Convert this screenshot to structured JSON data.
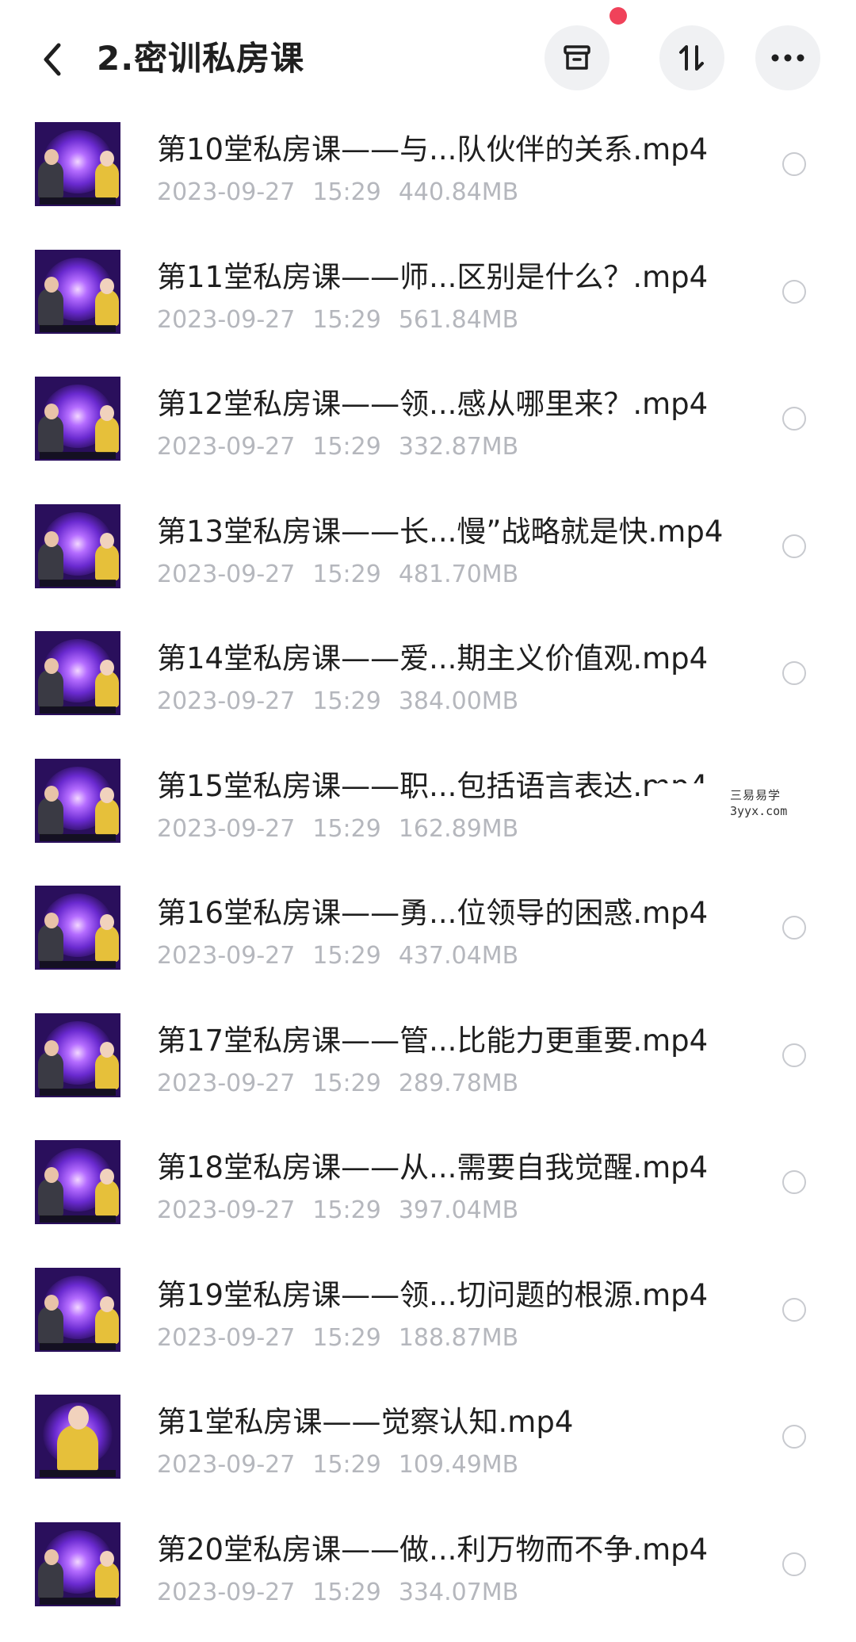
{
  "header": {
    "title": "2.密训私房课",
    "back_icon": "chevron-left-icon",
    "archive_icon": "archive-box-icon",
    "sort_icon": "sort-arrows-icon",
    "more_icon": "more-dots-icon",
    "notification_dot_color": "#f0425a"
  },
  "files": [
    {
      "name": "第10堂私房课——与...队伙伴的关系.mp4",
      "date": "2023-09-27",
      "time": "15:29",
      "size": "440.84MB",
      "thumb": "duo"
    },
    {
      "name": "第11堂私房课——师...区别是什么？.mp4",
      "date": "2023-09-27",
      "time": "15:29",
      "size": "561.84MB",
      "thumb": "duo"
    },
    {
      "name": "第12堂私房课——领...感从哪里来？.mp4",
      "date": "2023-09-27",
      "time": "15:29",
      "size": "332.87MB",
      "thumb": "duo"
    },
    {
      "name": "第13堂私房课——长...慢”战略就是快.mp4",
      "date": "2023-09-27",
      "time": "15:29",
      "size": "481.70MB",
      "thumb": "duo"
    },
    {
      "name": "第14堂私房课——爱...期主义价值观.mp4",
      "date": "2023-09-27",
      "time": "15:29",
      "size": "384.00MB",
      "thumb": "duo"
    },
    {
      "name": "第15堂私房课——职...包括语言表达.mp4",
      "date": "2023-09-27",
      "time": "15:29",
      "size": "162.89MB",
      "thumb": "duo"
    },
    {
      "name": "第16堂私房课——勇...位领导的困惑.mp4",
      "date": "2023-09-27",
      "time": "15:29",
      "size": "437.04MB",
      "thumb": "duo"
    },
    {
      "name": "第17堂私房课——管...比能力更重要.mp4",
      "date": "2023-09-27",
      "time": "15:29",
      "size": "289.78MB",
      "thumb": "duo"
    },
    {
      "name": "第18堂私房课——从...需要自我觉醒.mp4",
      "date": "2023-09-27",
      "time": "15:29",
      "size": "397.04MB",
      "thumb": "duo"
    },
    {
      "name": "第19堂私房课——领...切问题的根源.mp4",
      "date": "2023-09-27",
      "time": "15:29",
      "size": "188.87MB",
      "thumb": "duo"
    },
    {
      "name": "第1堂私房课——觉察认知.mp4",
      "date": "2023-09-27",
      "time": "15:29",
      "size": "109.49MB",
      "thumb": "solo"
    },
    {
      "name": "第20堂私房课——做...利万物而不争.mp4",
      "date": "2023-09-27",
      "time": "15:29",
      "size": "334.07MB",
      "thumb": "duo"
    }
  ],
  "watermark": {
    "line1": "三易易学",
    "line2": "3yyx.com"
  }
}
